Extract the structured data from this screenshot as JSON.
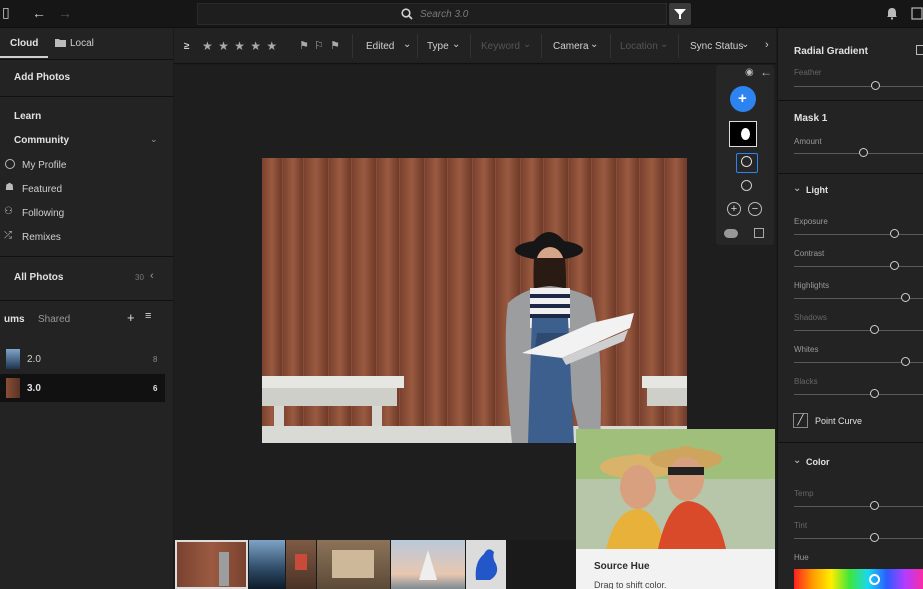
{
  "topbar": {
    "search_placeholder": "Search 3.0"
  },
  "sidebar": {
    "tab_cloud": "Cloud",
    "tab_local": "Local",
    "add_photos": "Add Photos",
    "learn": "Learn",
    "community": "Community",
    "community_items": [
      "My Profile",
      "Featured",
      "Following",
      "Remixes"
    ],
    "all_photos": "All Photos",
    "all_photos_count": "30",
    "albums_tab": "ums",
    "shared_tab": "Shared",
    "albums": [
      {
        "name": "2.0",
        "count": "8"
      },
      {
        "name": "3.0",
        "count": "6"
      }
    ]
  },
  "filterbar": {
    "flag_symbol": "≥",
    "stars": "★ ★ ★ ★ ★",
    "edited": "Edited",
    "type": "Type",
    "keyword": "Keyword",
    "camera": "Camera",
    "location": "Location",
    "sync_status": "Sync Status"
  },
  "tooltip": {
    "title": "Source Hue",
    "description": "Drag to shift color."
  },
  "rightpanel": {
    "radial_gradient": "Radial Gradient",
    "feather": "Feather",
    "mask1": "Mask 1",
    "amount": "Amount",
    "light": "Light",
    "light_sliders": [
      "Exposure",
      "Contrast",
      "Highlights",
      "Shadows",
      "Whites",
      "Blacks"
    ],
    "point_curve": "Point Curve",
    "color": "Color",
    "color_sliders": [
      "Temp",
      "Tint",
      "Hue"
    ]
  },
  "colors": {
    "accent_blue": "#2d84f0",
    "wood": "#8a4e36"
  }
}
